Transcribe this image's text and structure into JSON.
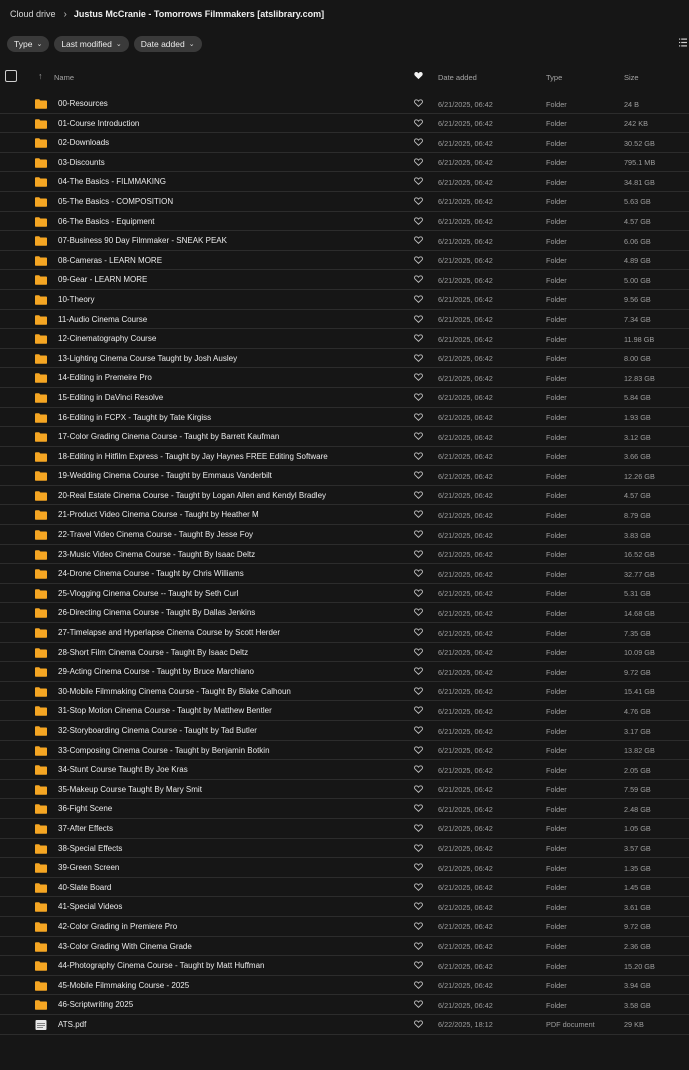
{
  "breadcrumb": {
    "root": "Cloud drive",
    "separator": "›",
    "current": "Justus McCranie - Tomorrows Filmmakers [atslibrary.com]"
  },
  "filters": [
    {
      "label": "Type"
    },
    {
      "label": "Last modified"
    },
    {
      "label": "Date added"
    }
  ],
  "columns": {
    "name": "Name",
    "date_added": "Date added",
    "type": "Type",
    "size": "Size"
  },
  "colors": {
    "folder": "#f5a623",
    "background": "#161616",
    "divider": "#2c2c2c"
  },
  "files": [
    {
      "name": "00-Resources",
      "date": "6/21/2025, 06:42",
      "type": "Folder",
      "size": "24 B",
      "icon": "folder-icon"
    },
    {
      "name": "01-Course Introduction",
      "date": "6/21/2025, 06:42",
      "type": "Folder",
      "size": "242 KB",
      "icon": "folder-icon"
    },
    {
      "name": "02-Downloads",
      "date": "6/21/2025, 06:42",
      "type": "Folder",
      "size": "30.52 GB",
      "icon": "folder-icon"
    },
    {
      "name": "03-Discounts",
      "date": "6/21/2025, 06:42",
      "type": "Folder",
      "size": "795.1 MB",
      "icon": "folder-icon"
    },
    {
      "name": "04-The Basics - FILMMAKING",
      "date": "6/21/2025, 06:42",
      "type": "Folder",
      "size": "34.81 GB",
      "icon": "folder-icon"
    },
    {
      "name": "05-The Basics - COMPOSITION",
      "date": "6/21/2025, 06:42",
      "type": "Folder",
      "size": "5.63 GB",
      "icon": "folder-icon"
    },
    {
      "name": "06-The Basics - Equipment",
      "date": "6/21/2025, 06:42",
      "type": "Folder",
      "size": "4.57 GB",
      "icon": "folder-icon"
    },
    {
      "name": "07-Business 90 Day Filmmaker - SNEAK PEAK",
      "date": "6/21/2025, 06:42",
      "type": "Folder",
      "size": "6.06 GB",
      "icon": "folder-icon"
    },
    {
      "name": "08-Cameras - LEARN MORE",
      "date": "6/21/2025, 06:42",
      "type": "Folder",
      "size": "4.89 GB",
      "icon": "folder-icon"
    },
    {
      "name": "09-Gear - LEARN MORE",
      "date": "6/21/2025, 06:42",
      "type": "Folder",
      "size": "5.00 GB",
      "icon": "folder-icon"
    },
    {
      "name": "10-Theory",
      "date": "6/21/2025, 06:42",
      "type": "Folder",
      "size": "9.56 GB",
      "icon": "folder-icon"
    },
    {
      "name": "11-Audio Cinema Course",
      "date": "6/21/2025, 06:42",
      "type": "Folder",
      "size": "7.34 GB",
      "icon": "folder-icon"
    },
    {
      "name": "12-Cinematography Course",
      "date": "6/21/2025, 06:42",
      "type": "Folder",
      "size": "11.98 GB",
      "icon": "folder-icon"
    },
    {
      "name": "13-Lighting Cinema Course Taught by Josh Ausley",
      "date": "6/21/2025, 06:42",
      "type": "Folder",
      "size": "8.00 GB",
      "icon": "folder-icon"
    },
    {
      "name": "14-Editing in Premeire Pro",
      "date": "6/21/2025, 06:42",
      "type": "Folder",
      "size": "12.83 GB",
      "icon": "folder-icon"
    },
    {
      "name": "15-Editing in DaVinci Resolve",
      "date": "6/21/2025, 06:42",
      "type": "Folder",
      "size": "5.84 GB",
      "icon": "folder-icon"
    },
    {
      "name": "16-Editing in FCPX - Taught by Tate Kirgiss",
      "date": "6/21/2025, 06:42",
      "type": "Folder",
      "size": "1.93 GB",
      "icon": "folder-icon"
    },
    {
      "name": "17-Color Grading Cinema Course - Taught by Barrett Kaufman",
      "date": "6/21/2025, 06:42",
      "type": "Folder",
      "size": "3.12 GB",
      "icon": "folder-icon"
    },
    {
      "name": "18-Editing in Hitfilm Express - Taught by Jay Haynes FREE Editing Software",
      "date": "6/21/2025, 06:42",
      "type": "Folder",
      "size": "3.66 GB",
      "icon": "folder-icon"
    },
    {
      "name": "19-Wedding Cinema Course - Taught by Emmaus Vanderbilt",
      "date": "6/21/2025, 06:42",
      "type": "Folder",
      "size": "12.26 GB",
      "icon": "folder-icon"
    },
    {
      "name": "20-Real Estate Cinema Course - Taught by Logan Allen and Kendyl Bradley",
      "date": "6/21/2025, 06:42",
      "type": "Folder",
      "size": "4.57 GB",
      "icon": "folder-icon"
    },
    {
      "name": "21-Product Video Cinema Course - Taught by Heather M",
      "date": "6/21/2025, 06:42",
      "type": "Folder",
      "size": "8.79 GB",
      "icon": "folder-icon"
    },
    {
      "name": "22-Travel Video Cinema Course - Taught By Jesse Foy",
      "date": "6/21/2025, 06:42",
      "type": "Folder",
      "size": "3.83 GB",
      "icon": "folder-icon"
    },
    {
      "name": "23-Music Video Cinema Course - Taught By Isaac Deltz",
      "date": "6/21/2025, 06:42",
      "type": "Folder",
      "size": "16.52 GB",
      "icon": "folder-icon"
    },
    {
      "name": "24-Drone Cinema Course - Taught by Chris Williams",
      "date": "6/21/2025, 06:42",
      "type": "Folder",
      "size": "32.77 GB",
      "icon": "folder-icon"
    },
    {
      "name": "25-Vlogging Cinema Course -- Taught by Seth Curl",
      "date": "6/21/2025, 06:42",
      "type": "Folder",
      "size": "5.31 GB",
      "icon": "folder-icon"
    },
    {
      "name": "26-Directing Cinema Course - Taught By Dallas Jenkins",
      "date": "6/21/2025, 06:42",
      "type": "Folder",
      "size": "14.68 GB",
      "icon": "folder-icon"
    },
    {
      "name": "27-Timelapse and Hyperlapse Cinema Course by Scott Herder",
      "date": "6/21/2025, 06:42",
      "type": "Folder",
      "size": "7.35 GB",
      "icon": "folder-icon"
    },
    {
      "name": "28-Short Film Cinema Course - Taught By Isaac Deltz",
      "date": "6/21/2025, 06:42",
      "type": "Folder",
      "size": "10.09 GB",
      "icon": "folder-icon"
    },
    {
      "name": "29-Acting Cinema Course - Taught by Bruce Marchiano",
      "date": "6/21/2025, 06:42",
      "type": "Folder",
      "size": "9.72 GB",
      "icon": "folder-icon"
    },
    {
      "name": "30-Mobile Filmmaking Cinema Course - Taught By Blake Calhoun",
      "date": "6/21/2025, 06:42",
      "type": "Folder",
      "size": "15.41 GB",
      "icon": "folder-icon"
    },
    {
      "name": "31-Stop Motion Cinema Course - Taught by Matthew Bentler",
      "date": "6/21/2025, 06:42",
      "type": "Folder",
      "size": "4.76 GB",
      "icon": "folder-icon"
    },
    {
      "name": "32-Storyboarding Cinema Course - Taught by Tad Butler",
      "date": "6/21/2025, 06:42",
      "type": "Folder",
      "size": "3.17 GB",
      "icon": "folder-icon"
    },
    {
      "name": "33-Composing Cinema Course - Taught by Benjamin Botkin",
      "date": "6/21/2025, 06:42",
      "type": "Folder",
      "size": "13.82 GB",
      "icon": "folder-icon"
    },
    {
      "name": "34-Stunt Course Taught By Joe Kras",
      "date": "6/21/2025, 06:42",
      "type": "Folder",
      "size": "2.05 GB",
      "icon": "folder-icon"
    },
    {
      "name": "35-Makeup Course Taught By Mary Smit",
      "date": "6/21/2025, 06:42",
      "type": "Folder",
      "size": "7.59 GB",
      "icon": "folder-icon"
    },
    {
      "name": "36-Fight Scene",
      "date": "6/21/2025, 06:42",
      "type": "Folder",
      "size": "2.48 GB",
      "icon": "folder-icon"
    },
    {
      "name": "37-After Effects",
      "date": "6/21/2025, 06:42",
      "type": "Folder",
      "size": "1.05 GB",
      "icon": "folder-icon"
    },
    {
      "name": "38-Special Effects",
      "date": "6/21/2025, 06:42",
      "type": "Folder",
      "size": "3.57 GB",
      "icon": "folder-icon"
    },
    {
      "name": "39-Green Screen",
      "date": "6/21/2025, 06:42",
      "type": "Folder",
      "size": "1.35 GB",
      "icon": "folder-icon"
    },
    {
      "name": "40-Slate Board",
      "date": "6/21/2025, 06:42",
      "type": "Folder",
      "size": "1.45 GB",
      "icon": "folder-icon"
    },
    {
      "name": "41-Special Videos",
      "date": "6/21/2025, 06:42",
      "type": "Folder",
      "size": "3.61 GB",
      "icon": "folder-icon"
    },
    {
      "name": "42-Color Grading in Premiere Pro",
      "date": "6/21/2025, 06:42",
      "type": "Folder",
      "size": "9.72 GB",
      "icon": "folder-icon"
    },
    {
      "name": "43-Color Grading With Cinema Grade",
      "date": "6/21/2025, 06:42",
      "type": "Folder",
      "size": "2.36 GB",
      "icon": "folder-icon"
    },
    {
      "name": "44-Photography Cinema Course - Taught by Matt Huffman",
      "date": "6/21/2025, 06:42",
      "type": "Folder",
      "size": "15.20 GB",
      "icon": "folder-icon"
    },
    {
      "name": "45-Mobile Filmmaking Course - 2025",
      "date": "6/21/2025, 06:42",
      "type": "Folder",
      "size": "3.94 GB",
      "icon": "folder-icon"
    },
    {
      "name": "46-Scriptwriting 2025",
      "date": "6/21/2025, 06:42",
      "type": "Folder",
      "size": "3.58 GB",
      "icon": "folder-icon"
    },
    {
      "name": "ATS.pdf",
      "date": "6/22/2025, 18:12",
      "type": "PDF document",
      "size": "29 KB",
      "icon": "pdf-icon"
    }
  ]
}
